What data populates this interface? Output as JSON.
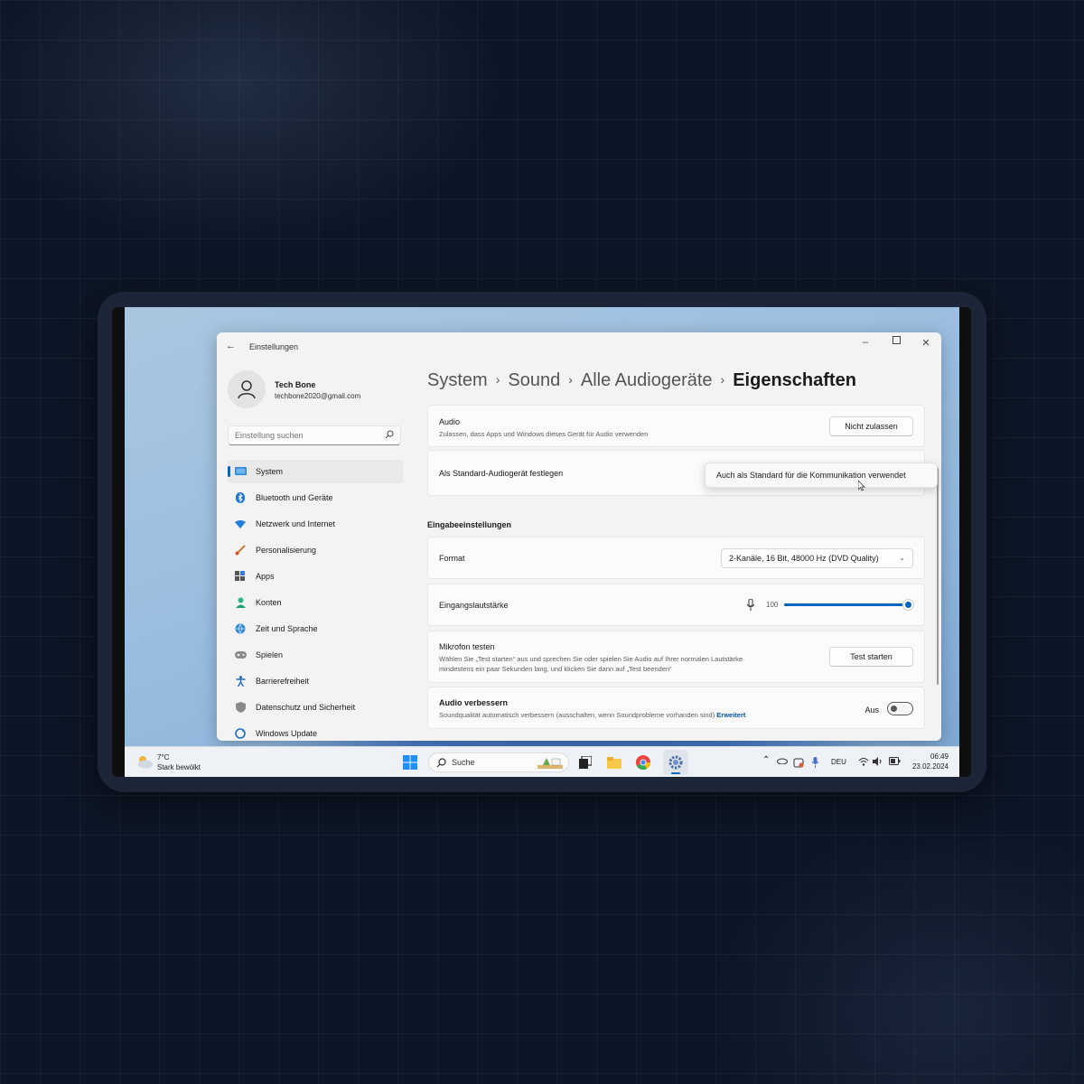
{
  "window": {
    "title": "Einstellungen",
    "minimize_icon": "minimize-icon",
    "maximize_icon": "maximize-icon",
    "close_icon": "close-icon"
  },
  "user": {
    "name": "Tech Bone",
    "email": "techbone2020@gmail.com"
  },
  "search": {
    "placeholder": "Einstellung suchen"
  },
  "sidebar": {
    "items": [
      {
        "label": "System",
        "icon": "monitor-icon",
        "active": true
      },
      {
        "label": "Bluetooth und Geräte",
        "icon": "bluetooth-icon"
      },
      {
        "label": "Netzwerk und Internet",
        "icon": "wifi-icon"
      },
      {
        "label": "Personalisierung",
        "icon": "brush-icon"
      },
      {
        "label": "Apps",
        "icon": "apps-icon"
      },
      {
        "label": "Konten",
        "icon": "person-icon"
      },
      {
        "label": "Zeit und Sprache",
        "icon": "globe-clock-icon"
      },
      {
        "label": "Spielen",
        "icon": "gamepad-icon"
      },
      {
        "label": "Barrierefreiheit",
        "icon": "accessibility-icon"
      },
      {
        "label": "Datenschutz und Sicherheit",
        "icon": "shield-icon"
      },
      {
        "label": "Windows Update",
        "icon": "update-icon"
      }
    ]
  },
  "breadcrumb": {
    "items": [
      "System",
      "Sound",
      "Alle Audiogeräte"
    ],
    "current": "Eigenschaften"
  },
  "audio": {
    "label": "Audio",
    "description": "Zulassen, dass Apps und Windows dieses Gerät für Audio verwenden",
    "button": "Nicht zulassen"
  },
  "default_device": {
    "label": "Als Standard-Audiogerät festlegen",
    "popup_option": "Auch als Standard für die Kommunikation verwendet"
  },
  "input_section": {
    "heading": "Eingabeeinstellungen"
  },
  "format": {
    "label": "Format",
    "value": "2-Kanäle, 16 Bit, 48000 Hz (DVD Quality)"
  },
  "input_volume": {
    "label": "Eingangslautstärke",
    "value": "100",
    "level": 1.0
  },
  "mic_test": {
    "label": "Mikrofon testen",
    "description_line1": "Wählen Sie „Test starten“ aus und sprechen Sie oder spielen Sie Audio auf Ihrer normalen Lautstärke",
    "description_line2": "mindestens ein paar Sekunden lang, und klicken Sie dann auf „Test beenden“",
    "button": "Test starten"
  },
  "enhance": {
    "label": "Audio verbessern",
    "description": "Soundqualität automatisch verbessern (ausschalten, wenn Soundprobleme vorhanden sind)",
    "link": "Erweitert",
    "state": "Aus"
  },
  "taskbar": {
    "weather_temp": "7°C",
    "weather_desc": "Stark bewölkt",
    "search": "Suche",
    "language": "DEU",
    "time": "06:49",
    "date": "23.02.2024"
  },
  "colors": {
    "accent": "#0067c0",
    "window_bg": "#f3f3f3",
    "card_bg": "#fbfbfb"
  }
}
